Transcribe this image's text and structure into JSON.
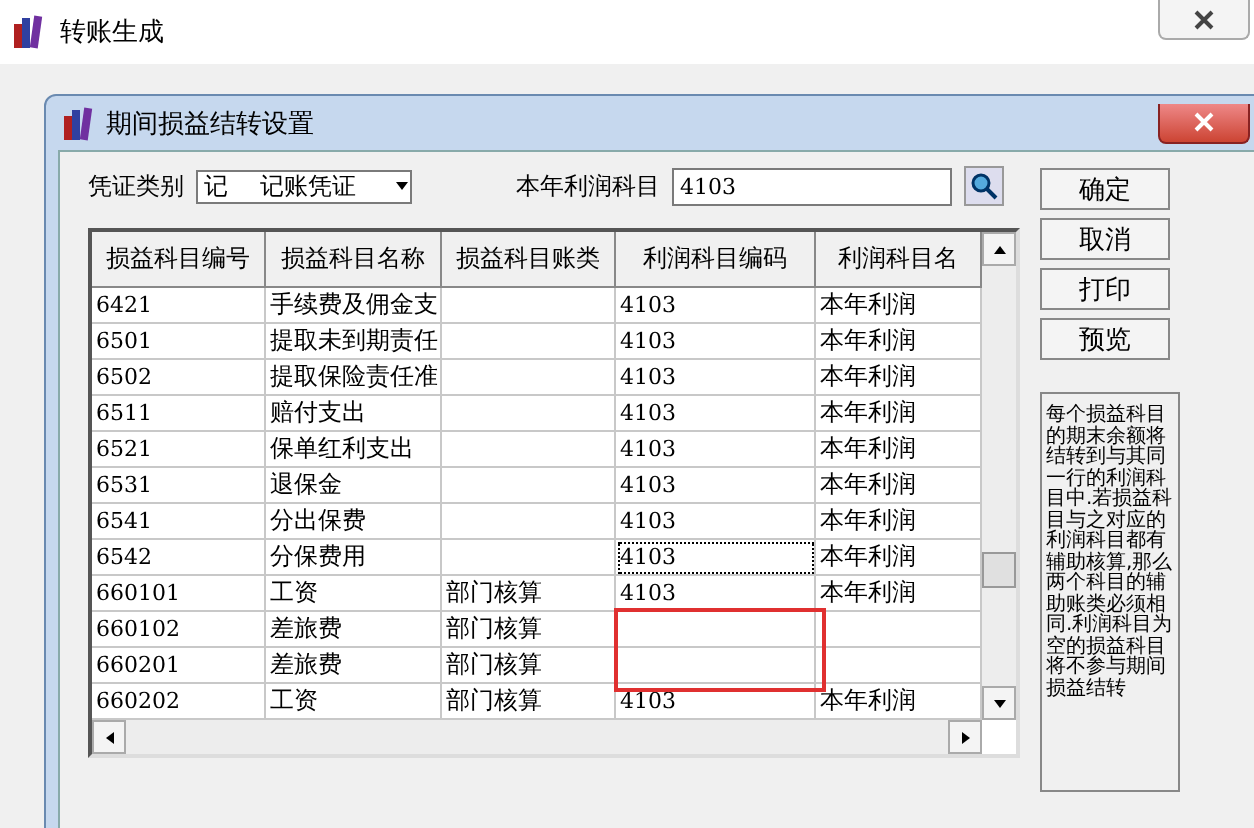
{
  "app_window": {
    "title": "转账生成"
  },
  "dialog": {
    "title": "期间损益结转设置",
    "voucher_type": {
      "label": "凭证类别",
      "code": "记",
      "name": "记账凭证"
    },
    "profit_account": {
      "label": "本年利润科目",
      "value": "4103"
    },
    "buttons": [
      "确定",
      "取消",
      "打印",
      "预览"
    ],
    "table": {
      "columns": [
        "损益科目编号",
        "损益科目名称",
        "损益科目账类",
        "利润科目编码",
        "利润科目名"
      ],
      "rows": [
        {
          "cells": [
            "6421",
            "手续费及佣金支",
            "",
            "4103",
            "本年利润"
          ],
          "focused": false,
          "marked": false
        },
        {
          "cells": [
            "6501",
            "提取未到期责任",
            "",
            "4103",
            "本年利润"
          ],
          "focused": false,
          "marked": false
        },
        {
          "cells": [
            "6502",
            "提取保险责任准",
            "",
            "4103",
            "本年利润"
          ],
          "focused": false,
          "marked": false
        },
        {
          "cells": [
            "6511",
            "赔付支出",
            "",
            "4103",
            "本年利润"
          ],
          "focused": false,
          "marked": false
        },
        {
          "cells": [
            "6521",
            "保单红利支出",
            "",
            "4103",
            "本年利润"
          ],
          "focused": false,
          "marked": false
        },
        {
          "cells": [
            "6531",
            "退保金",
            "",
            "4103",
            "本年利润"
          ],
          "focused": false,
          "marked": false
        },
        {
          "cells": [
            "6541",
            "分出保费",
            "",
            "4103",
            "本年利润"
          ],
          "focused": false,
          "marked": false
        },
        {
          "cells": [
            "6542",
            "分保费用",
            "",
            "4103",
            "本年利润"
          ],
          "focused": true,
          "marked": false
        },
        {
          "cells": [
            "660101",
            "工资",
            "部门核算",
            "4103",
            "本年利润"
          ],
          "focused": false,
          "marked": false
        },
        {
          "cells": [
            "660102",
            "差旅费",
            "部门核算",
            "",
            ""
          ],
          "focused": false,
          "marked": true
        },
        {
          "cells": [
            "660201",
            "差旅费",
            "部门核算",
            "",
            ""
          ],
          "focused": false,
          "marked": true
        },
        {
          "cells": [
            "660202",
            "工资",
            "部门核算",
            "4103",
            "本年利润"
          ],
          "focused": false,
          "marked": false
        }
      ]
    },
    "note": "每个损益科目的期末余额将结转到与其同一行的利润科目中.若损益科目与之对应的利润科目都有辅助核算,那么两个科目的辅助账类必须相同.利润科目为空的损益科目将不参与期间损益结转"
  }
}
